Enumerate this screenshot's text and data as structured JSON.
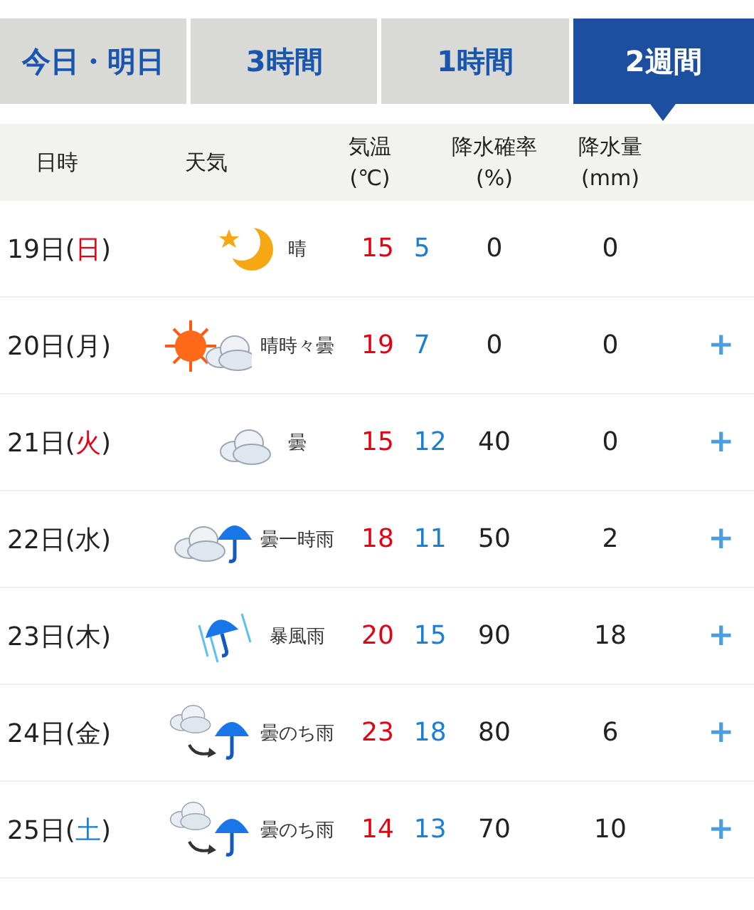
{
  "tabs": [
    {
      "label": "今日・明日",
      "selected": false
    },
    {
      "label": "3時間",
      "selected": false
    },
    {
      "label": "1時間",
      "selected": false
    },
    {
      "label": "2週間",
      "selected": true
    }
  ],
  "columns": [
    {
      "label": "日時"
    },
    {
      "label": "天気"
    },
    {
      "label": "気温",
      "unit": "(℃)"
    },
    {
      "label": "降水確率",
      "unit": "(%)"
    },
    {
      "label": "降水量",
      "unit": "(mm)"
    }
  ],
  "rows": [
    {
      "day": "19日(",
      "weekday": {
        "label": "日",
        "color": "#e60012"
      },
      "close": ")",
      "kind": "moon",
      "weather": "晴",
      "high": "15",
      "low": "5",
      "rain_chance": "0",
      "rain_amount": "0"
    },
    {
      "day": "20日(",
      "weekday": {
        "label": "月",
        "color": "#222222"
      },
      "close": ")",
      "kind": "sun_cloud",
      "weather": "晴時々曇",
      "high": "19",
      "low": "7",
      "rain_chance": "0",
      "rain_amount": "0",
      "expand": "+"
    },
    {
      "day": "21日(",
      "weekday": {
        "label": "火",
        "color": "#e60012"
      },
      "close": ")",
      "kind": "cloud",
      "weather": "曇",
      "high": "15",
      "low": "12",
      "rain_chance": "40",
      "rain_amount": "0",
      "expand": "+"
    },
    {
      "day": "22日(",
      "weekday": {
        "label": "水",
        "color": "#222222"
      },
      "close": ")",
      "kind": "cloud_rain",
      "weather": "曇一時雨",
      "high": "18",
      "low": "11",
      "rain_chance": "50",
      "rain_amount": "2",
      "expand": "+"
    },
    {
      "day": "23日(",
      "weekday": {
        "label": "木",
        "color": "#222222"
      },
      "close": ")",
      "kind": "storm",
      "weather": "暴風雨",
      "high": "20",
      "low": "15",
      "rain_chance": "90",
      "rain_amount": "18",
      "expand": "+"
    },
    {
      "day": "24日(",
      "weekday": {
        "label": "金",
        "color": "#222222"
      },
      "close": ")",
      "kind": "cloud_then_rain",
      "weather": "曇のち雨",
      "high": "23",
      "low": "18",
      "rain_chance": "80",
      "rain_amount": "6",
      "expand": "+"
    },
    {
      "day": "25日(",
      "weekday": {
        "label": "土",
        "color": "#1a7fd4"
      },
      "close": ")",
      "kind": "cloud_then_rain",
      "weather": "曇のち雨",
      "high": "14",
      "low": "13",
      "rain_chance": "70",
      "rain_amount": "10",
      "expand": "+"
    }
  ]
}
